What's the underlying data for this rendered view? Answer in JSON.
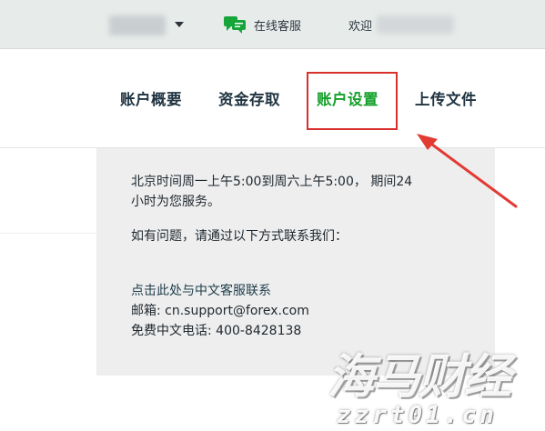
{
  "topbar": {
    "account_redacted": "",
    "support_label": "在线客服",
    "welcome_label": "欢迎",
    "username_redacted": ""
  },
  "nav": {
    "items": [
      {
        "label": "账户概要"
      },
      {
        "label": "资金存取"
      },
      {
        "label": "账户设置"
      },
      {
        "label": "上传文件"
      }
    ]
  },
  "panel": {
    "hours_line1": "北京时间周一上午5:00到周六上午5:00， 期间24",
    "hours_line2": "小时为您服务。",
    "question": "如有问题，请通过以下方式联系我们：",
    "chinese_support_link": "点击此处与中文客服联系",
    "email": "邮箱: cn.support@forex.com",
    "phone": "免费中文电话: 400-8428138"
  },
  "watermark": {
    "title": "海马财经",
    "url": "zzrt01.cn"
  },
  "colors": {
    "active_nav": "#14a02a",
    "highlight_border": "#d9302c",
    "chat_icon": "#17a53a"
  },
  "icons": {
    "chat": "chat-bubbles-icon",
    "caret": "chevron-down-icon"
  }
}
